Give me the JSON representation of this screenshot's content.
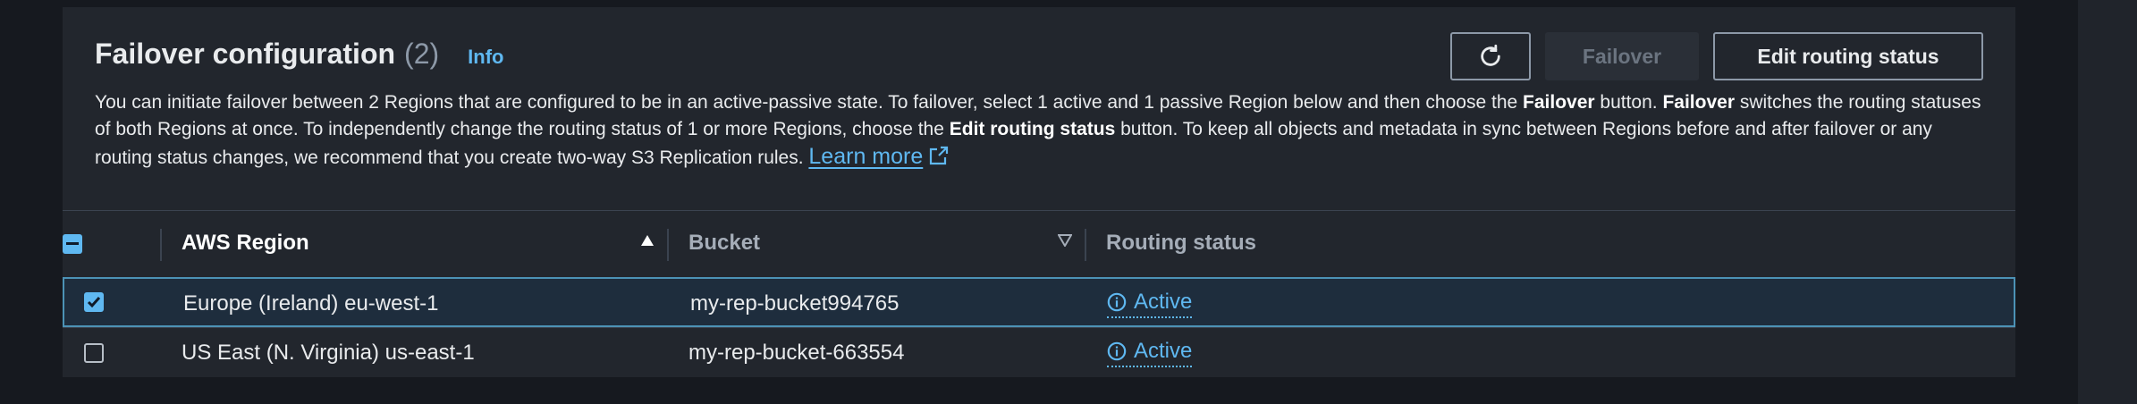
{
  "panel": {
    "title": "Failover configuration",
    "count": "(2)",
    "info_label": "Info",
    "description_parts": {
      "p1": "You can initiate failover between 2 Regions that are configured to be in an active-passive state. To failover, select 1 active and 1 passive Region below and then choose the ",
      "b1": "Failover",
      "p2": " button. ",
      "b2": "Failover",
      "p3": " switches the routing statuses of both Regions at once. To independently change the routing status of 1 or more Regions, choose the ",
      "b3": "Edit routing status",
      "p4": " button. To keep all objects and metadata in sync between Regions before and after failover or any routing status changes, we recommend that you create two-way S3 Replication rules. "
    },
    "learn_more_label": "Learn more",
    "buttons": {
      "refresh_icon": "refresh-icon",
      "failover_label": "Failover",
      "edit_label": "Edit routing status"
    }
  },
  "table": {
    "columns": {
      "region": "AWS Region",
      "bucket": "Bucket",
      "routing": "Routing status"
    },
    "rows": [
      {
        "region": "Europe (Ireland) eu-west-1",
        "bucket": "my-rep-bucket994765",
        "status": "Active",
        "selected": true
      },
      {
        "region": "US East (N. Virginia) us-east-1",
        "bucket": "my-rep-bucket-663554",
        "status": "Active",
        "selected": false
      }
    ]
  },
  "colors": {
    "accent": "#5fb8f1",
    "panel_bg": "#22262d",
    "page_bg": "#16191f",
    "selected_row_border": "#4c92b5"
  }
}
